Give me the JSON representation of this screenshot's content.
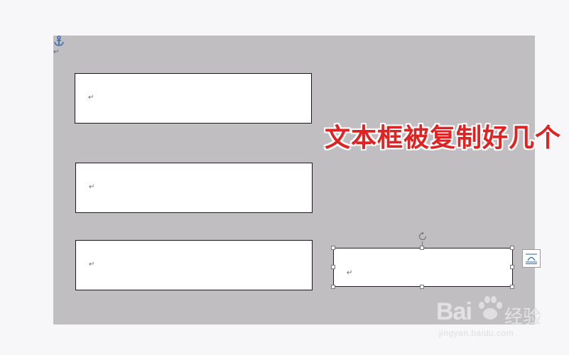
{
  "document": {
    "paragraph_mark": "↵"
  },
  "textboxes": [
    {
      "paragraph_mark": "↵"
    },
    {
      "paragraph_mark": "↵"
    },
    {
      "paragraph_mark": "↵"
    },
    {
      "paragraph_mark": "↵",
      "selected": true
    }
  ],
  "annotation": {
    "text": "文本框被复制好几个",
    "color": "#e02222"
  },
  "icons": {
    "anchor": "anchor-icon",
    "rotate": "rotate-handle-icon",
    "layout_options": "layout-options-icon"
  },
  "watermark": {
    "brand": "Bai",
    "brand_suffix": "经验",
    "url": "jingyan.baidu.com"
  },
  "colors": {
    "canvas": "#c0bec1",
    "page": "#f7f6f9",
    "textbox_border": "#1a1a1a",
    "anchor": "#3a6fb0"
  }
}
